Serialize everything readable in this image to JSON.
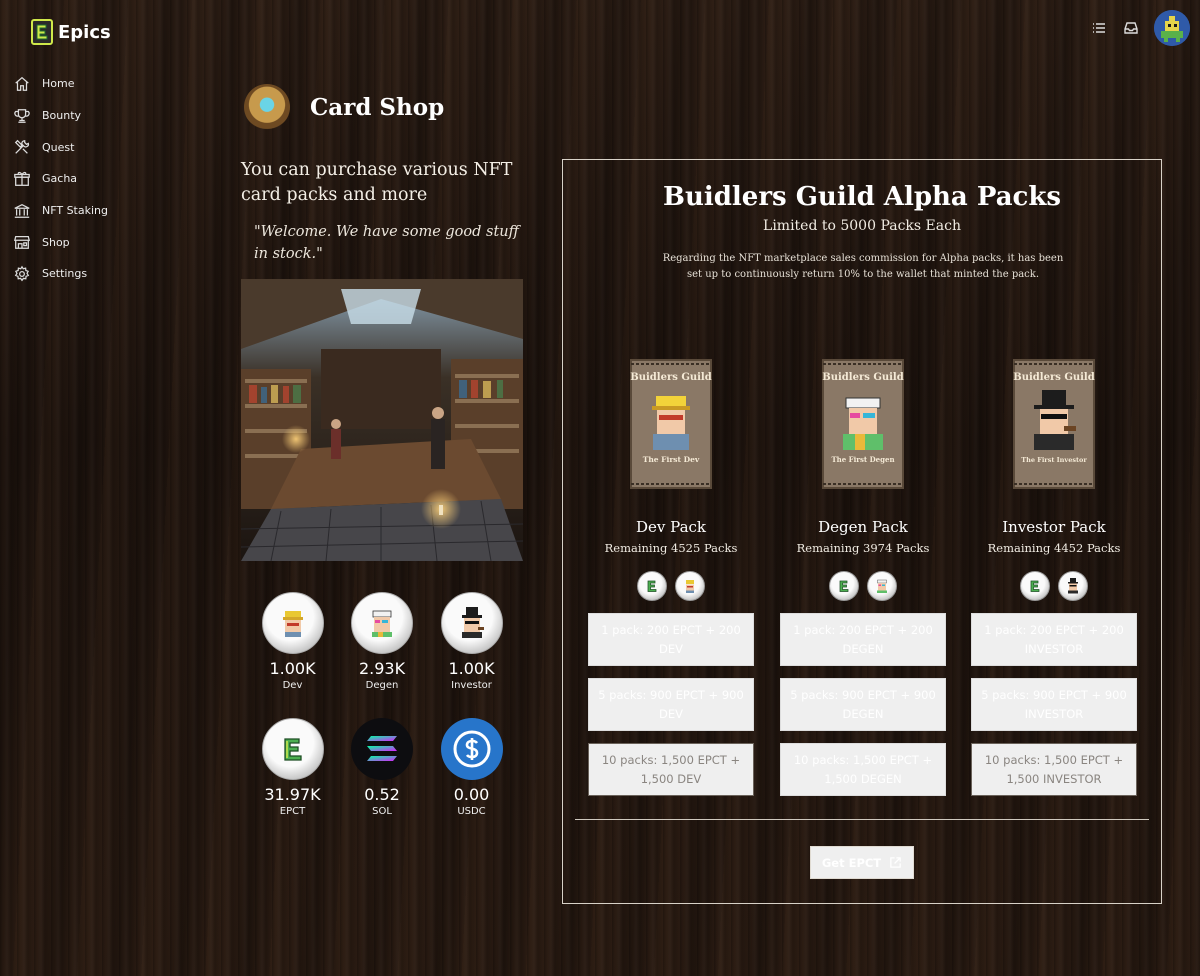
{
  "app": {
    "name": "Epics"
  },
  "sidebar": {
    "items": [
      {
        "label": "Home",
        "icon": "home-icon"
      },
      {
        "label": "Bounty",
        "icon": "trophy-icon"
      },
      {
        "label": "Quest",
        "icon": "tools-icon"
      },
      {
        "label": "Gacha",
        "icon": "gift-icon"
      },
      {
        "label": "NFT Staking",
        "icon": "bank-icon"
      },
      {
        "label": "Shop",
        "icon": "store-icon"
      },
      {
        "label": "Settings",
        "icon": "gear-icon"
      }
    ]
  },
  "header": {
    "icons": [
      "list-icon",
      "inbox-icon",
      "avatar"
    ]
  },
  "page": {
    "title": "Card Shop",
    "intro": "You can purchase various NFT card packs and more",
    "quote": "\"Welcome. We have some good stuff in stock.\""
  },
  "balances": [
    {
      "value": "1.00K",
      "label": "Dev"
    },
    {
      "value": "2.93K",
      "label": "Degen"
    },
    {
      "value": "1.00K",
      "label": "Investor"
    },
    {
      "value": "31.97K",
      "label": "EPCT"
    },
    {
      "value": "0.52",
      "label": "SOL"
    },
    {
      "value": "0.00",
      "label": "USDC"
    }
  ],
  "panel": {
    "title": "Buidlers Guild Alpha Packs",
    "subtitle": "Limited to 5000 Packs Each",
    "description": "Regarding the NFT marketplace sales commission for Alpha packs, it has been set up to continuously return 10% to the wallet that minted the pack.",
    "get_epct_label": "Get EPCT"
  },
  "packs": [
    {
      "name": "Dev Pack",
      "remaining": "Remaining 4525 Packs",
      "art_title": "Buidlers Guild",
      "art_caption": "The First Dev",
      "options": [
        {
          "label": "1 pack: 200 EPCT + 200 DEV",
          "enabled": true
        },
        {
          "label": "5 packs: 900 EPCT + 900 DEV",
          "enabled": true
        },
        {
          "label": "10 packs: 1,500 EPCT + 1,500 DEV",
          "enabled": false
        }
      ]
    },
    {
      "name": "Degen Pack",
      "remaining": "Remaining 3974 Packs",
      "art_title": "Buidlers Guild",
      "art_caption": "The First Degen",
      "options": [
        {
          "label": "1 pack: 200 EPCT + 200 DEGEN",
          "enabled": true
        },
        {
          "label": "5 packs: 900 EPCT + 900 DEGEN",
          "enabled": true
        },
        {
          "label": "10 packs: 1,500 EPCT + 1,500 DEGEN",
          "enabled": true
        }
      ]
    },
    {
      "name": "Investor Pack",
      "remaining": "Remaining 4452 Packs",
      "art_title": "Buidlers Guild",
      "art_caption": "The First Investor",
      "options": [
        {
          "label": "1 pack: 200 EPCT + 200 INVESTOR",
          "enabled": true
        },
        {
          "label": "5 packs: 900 EPCT + 900 INVESTOR",
          "enabled": true
        },
        {
          "label": "10 packs: 1,500 EPCT + 1,500 INVESTOR",
          "enabled": false
        }
      ]
    }
  ],
  "colors": {
    "background": "#221610",
    "usdc_blue": "#2775ca",
    "epct_green": "#4caf50"
  }
}
